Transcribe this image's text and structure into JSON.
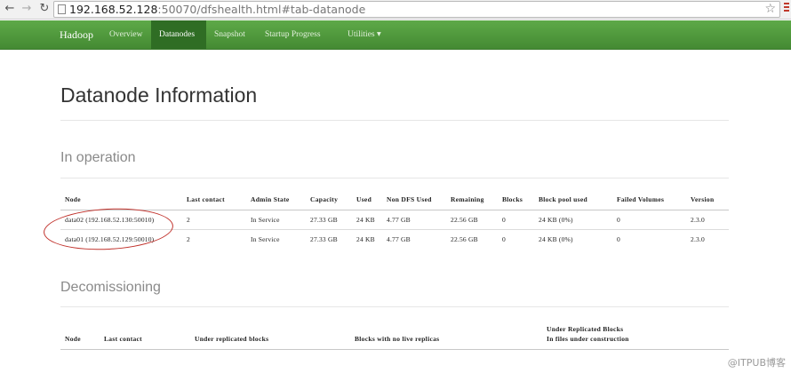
{
  "browser": {
    "url_host": "192.168.52.128",
    "url_rest": ":50070/dfshealth.html#tab-datanode"
  },
  "navbar": {
    "brand": "Hadoop",
    "items": [
      {
        "label": "Overview"
      },
      {
        "label": "Datanodes",
        "active": true
      },
      {
        "label": "Snapshot"
      },
      {
        "label": "Startup Progress"
      },
      {
        "label": "Utilities ▾"
      }
    ]
  },
  "page": {
    "title": "Datanode Information",
    "in_operation": {
      "heading": "In operation",
      "columns": [
        "Node",
        "Last contact",
        "Admin State",
        "Capacity",
        "Used",
        "Non DFS Used",
        "Remaining",
        "Blocks",
        "Block pool used",
        "Failed Volumes",
        "Version"
      ],
      "rows": [
        [
          "data02 (192.168.52.130:50010)",
          "2",
          "In Service",
          "27.33 GB",
          "24 KB",
          "4.77 GB",
          "22.56 GB",
          "0",
          "24 KB (0%)",
          "0",
          "2.3.0"
        ],
        [
          "data01 (192.168.52.129:50010)",
          "2",
          "In Service",
          "27.33 GB",
          "24 KB",
          "4.77 GB",
          "22.56 GB",
          "0",
          "24 KB (0%)",
          "0",
          "2.3.0"
        ]
      ]
    },
    "decommissioning": {
      "heading": "Decomissioning",
      "columns": [
        "Node",
        "Last contact",
        "Under replicated blocks",
        "Blocks with no live replicas",
        "Under Replicated Blocks",
        "In files under construction"
      ]
    }
  },
  "watermark": "@ITPUB博客"
}
